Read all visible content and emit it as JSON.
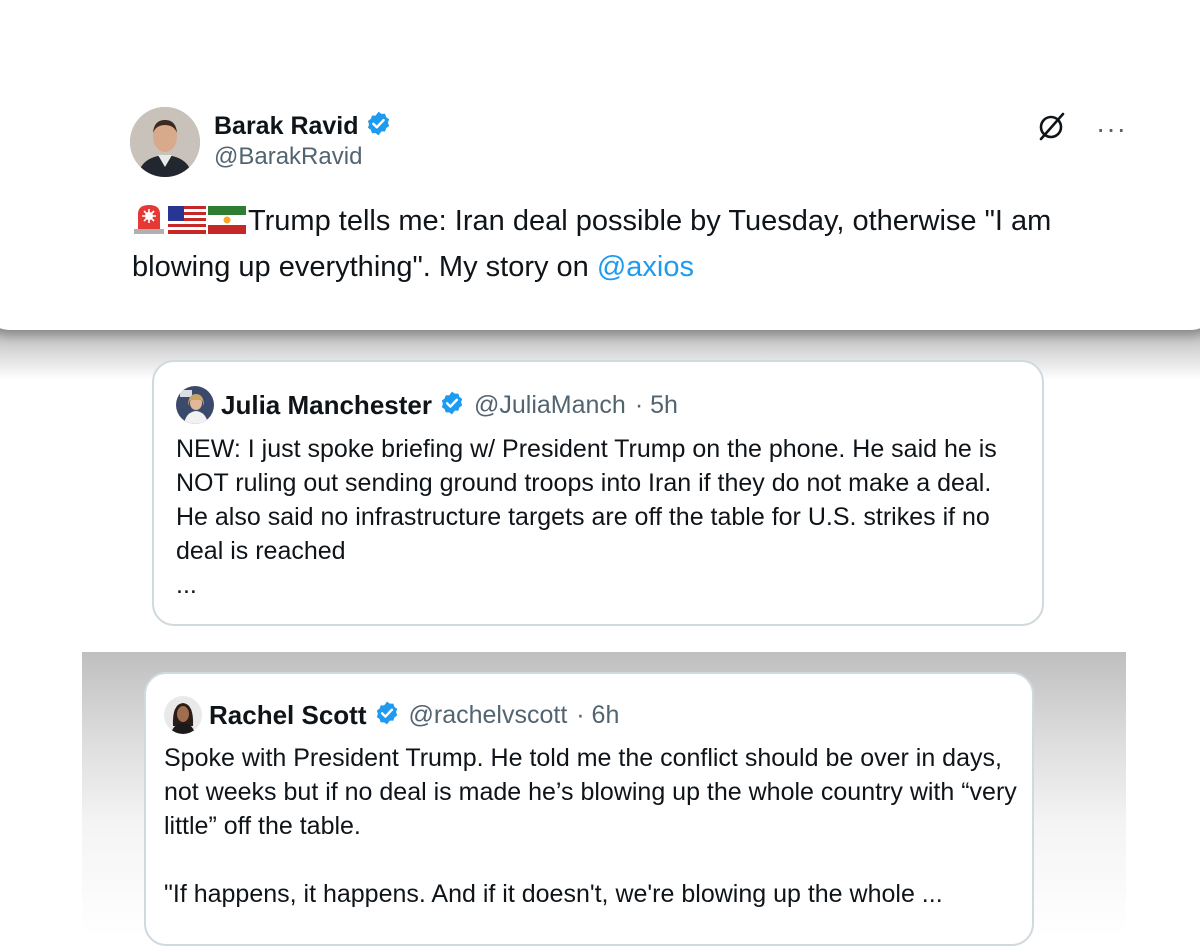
{
  "main_post": {
    "author_name": "Barak Ravid",
    "author_handle": "@BarakRavid",
    "text": "Trump tells me: Iran deal possible by Tuesday, otherwise \"I am blowing up everything\". My story on ",
    "mention": "@axios",
    "emojis": [
      "rotating-light",
      "us-flag",
      "iran-lion-sun-flag"
    ],
    "more_label": "···"
  },
  "quote1": {
    "author_name": "Julia Manchester",
    "author_handle": "@JuliaManch",
    "time": "· 5h",
    "text": "NEW: I just spoke briefing w/ President Trump on the phone. He said he is NOT ruling out sending ground troops into Iran if they do not make a deal. He also said no infrastructure targets are off the table for U.S. strikes if no deal is reached\n..."
  },
  "quote2": {
    "author_name": "Rachel Scott",
    "author_handle": "@rachelvscott",
    "time": "· 6h",
    "text": "Spoke with President Trump. He told me the conflict should be over in days, not weeks but if no deal is made he’s blowing up the whole country with “very little” off the table.\n\n\"If happens, it happens. And if it doesn't, we're blowing up the whole ..."
  },
  "colors": {
    "verified": "#1d9bf0",
    "link": "#1d9bf0",
    "secondary_text": "#536471",
    "border": "#cfd9de"
  }
}
